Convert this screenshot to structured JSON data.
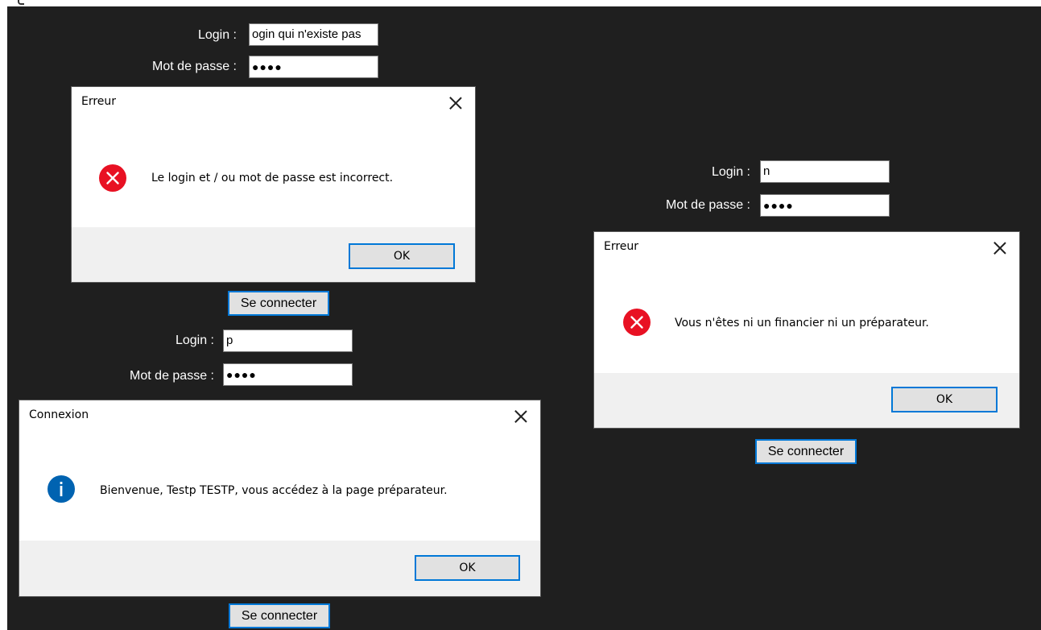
{
  "fields": {
    "login_label": "Login :",
    "password_label": "Mot de passe :"
  },
  "forms": [
    {
      "login_value": "ogin qui n'existe pas",
      "password_value": "●●●●",
      "connect_label": "Se connecter"
    },
    {
      "login_value": "n",
      "password_value": "●●●●",
      "connect_label": "Se connecter"
    },
    {
      "login_value": "p",
      "password_value": "●●●●",
      "connect_label": "Se connecter"
    }
  ],
  "dialogs": [
    {
      "title": "Erreur",
      "icon": "error-icon",
      "message": "Le login et / ou mot de passe est incorrect.",
      "ok_label": "OK"
    },
    {
      "title": "Erreur",
      "icon": "error-icon",
      "message": "Vous n'êtes ni un financier ni un préparateur.",
      "ok_label": "OK"
    },
    {
      "title": "Connexion",
      "icon": "info-icon",
      "message": "Bienvenue, Testp TESTP, vous accédez à la page préparateur.",
      "ok_label": "OK"
    }
  ],
  "colors": {
    "background": "#1f1f1f",
    "accent": "#0078d7",
    "error": "#e81123",
    "info": "#0063b1"
  }
}
